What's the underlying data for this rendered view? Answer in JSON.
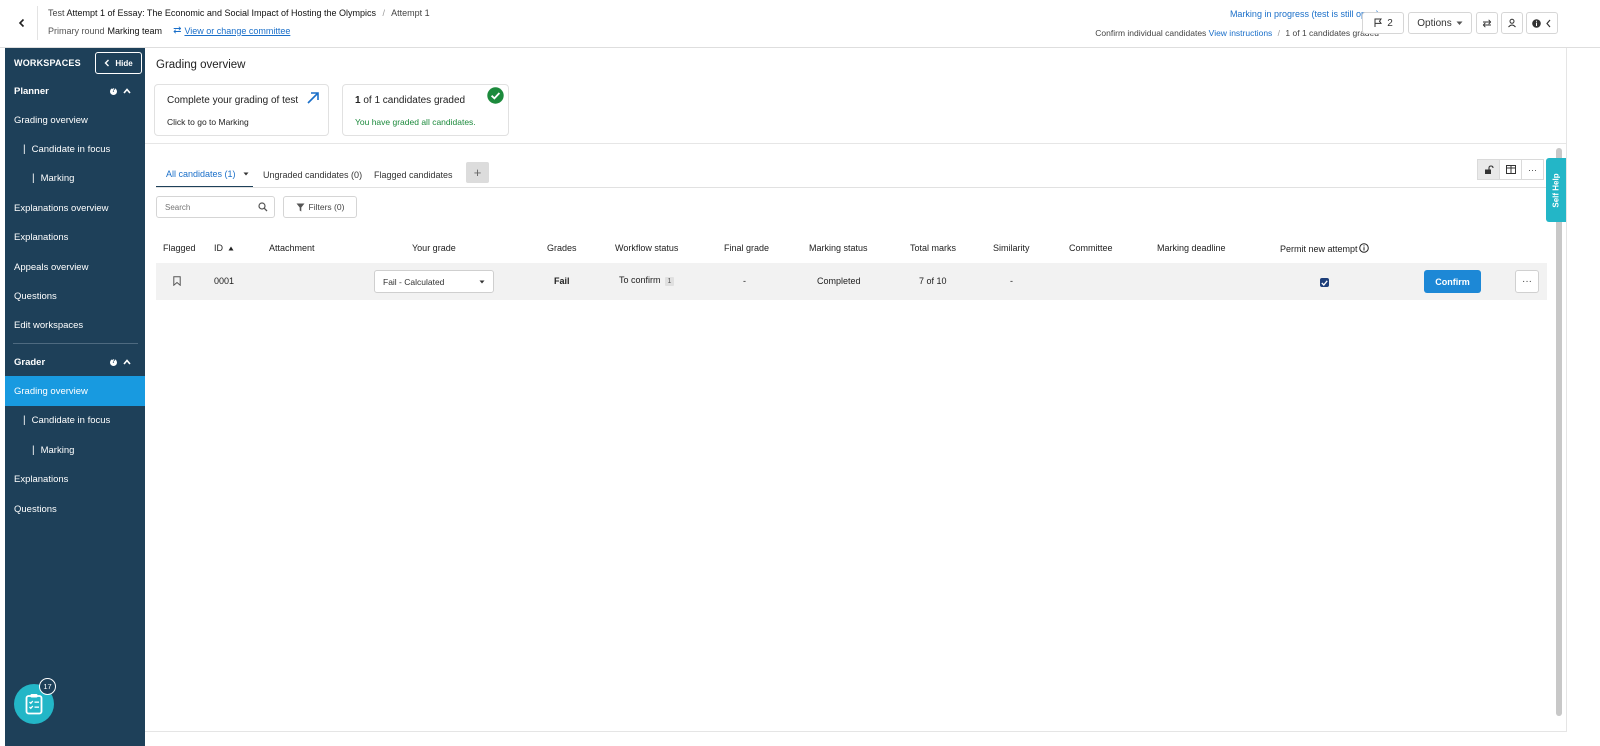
{
  "header": {
    "breadcrumb_prefix": "Test",
    "test_title": "Attempt 1 of Essay: The Economic and Social Impact of Hosting the Olympics",
    "attempt": "Attempt 1",
    "round_label": "Primary round",
    "team": "Marking team",
    "change_committee_link": "View or change committee",
    "marking_status": "Marking in progress (test is still open)",
    "confirm_text": "Confirm individual candidates",
    "view_instructions": "View instructions",
    "graded_progress": "1 of 1 candidates graded",
    "flag_count": "2",
    "options_label": "Options"
  },
  "sidebar": {
    "title": "WORKSPACES",
    "hide_label": "Hide",
    "groups": [
      {
        "label": "Planner",
        "items": [
          {
            "label": "Grading overview",
            "indent": 0
          },
          {
            "label": "Candidate in focus",
            "indent": 1
          },
          {
            "label": "Marking",
            "indent": 2
          },
          {
            "label": "Explanations overview",
            "indent": 0
          },
          {
            "label": "Explanations",
            "indent": 0
          },
          {
            "label": "Appeals overview",
            "indent": 0
          },
          {
            "label": "Questions",
            "indent": 0
          },
          {
            "label": "Edit workspaces",
            "indent": 0
          }
        ]
      },
      {
        "label": "Grader",
        "items": [
          {
            "label": "Grading overview",
            "indent": 0,
            "active": true
          },
          {
            "label": "Candidate in focus",
            "indent": 1
          },
          {
            "label": "Marking",
            "indent": 2
          },
          {
            "label": "Explanations",
            "indent": 0
          },
          {
            "label": "Questions",
            "indent": 0
          }
        ]
      }
    ],
    "fab_badge": "17"
  },
  "main": {
    "title": "Grading overview",
    "card_marking": {
      "title": "Complete your grading of test",
      "subtitle": "Click to go to Marking"
    },
    "card_progress": {
      "count": "1",
      "title_rest": "of 1 candidates graded",
      "subtitle": "You have graded all candidates."
    },
    "tabs": [
      {
        "label": "All candidates (1)",
        "active": true
      },
      {
        "label": "Ungraded candidates (0)"
      },
      {
        "label": "Flagged candidates"
      }
    ],
    "search_placeholder": "Search",
    "filters_label": "Filters (0)",
    "columns": [
      "Flagged",
      "ID",
      "Attachment",
      "Your grade",
      "Grades",
      "Workflow status",
      "Final grade",
      "Marking status",
      "Total marks",
      "Similarity",
      "Committee",
      "Marking deadline",
      "Permit new attempt"
    ],
    "row": {
      "id": "0001",
      "your_grade": "Fail - Calculated",
      "grades": "Fail",
      "workflow_status": "To confirm",
      "workflow_count": "1",
      "final_grade": "-",
      "marking_status": "Completed",
      "total_marks": "7 of 10",
      "similarity": "-",
      "permit_new_attempt": true,
      "confirm_label": "Confirm"
    }
  },
  "self_help_label": "Self Help",
  "colors": {
    "sidebar_bg": "#1e4059",
    "active_item": "#189ae0",
    "accent_blue": "#1a6fc9",
    "confirm_button": "#1d88d6",
    "success_green": "#1c8a3c",
    "self_help": "#23b6c7"
  }
}
